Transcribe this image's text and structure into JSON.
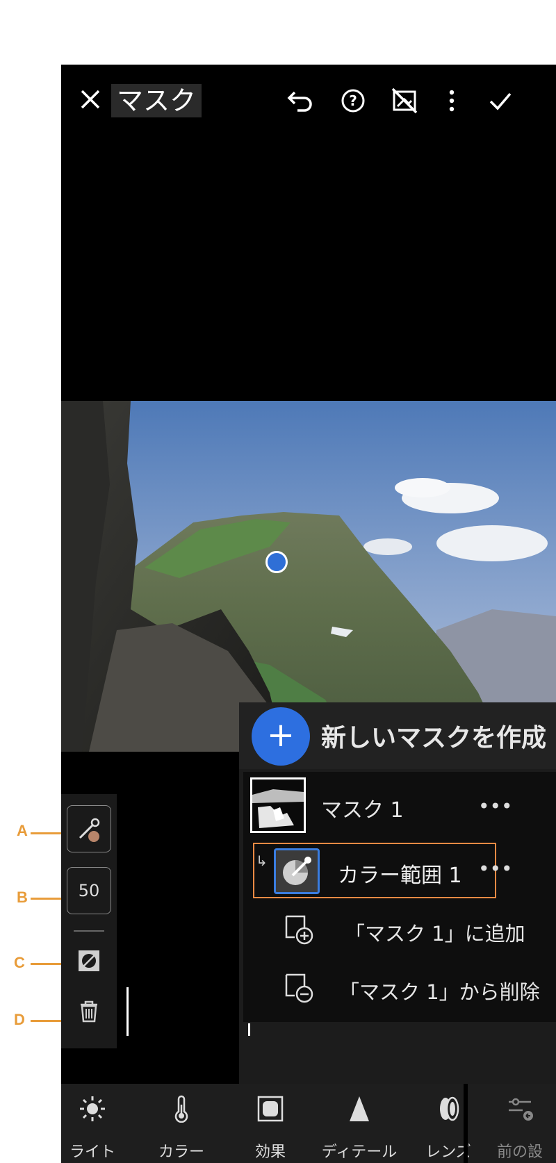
{
  "header": {
    "title": "マスク"
  },
  "photo": {
    "subject": "mountain-landscape"
  },
  "mask_panel": {
    "create_new_label": "新しいマスクを作成",
    "create_new_symbol": "+",
    "mask_name": "マスク 1",
    "color_range_name": "カラー範囲 1",
    "add_to_mask": "「マスク 1」に追加",
    "subtract_from_mask": "「マスク 1」から削除",
    "more_symbol": "•••"
  },
  "left_tools": {
    "amount_value": "50"
  },
  "callouts": [
    "A",
    "B",
    "C",
    "D"
  ],
  "bottom_bar": {
    "items": [
      {
        "label": "ライト",
        "icon": "sun-icon"
      },
      {
        "label": "カラー",
        "icon": "thermometer-icon"
      },
      {
        "label": "効果",
        "icon": "effects-icon"
      },
      {
        "label": "ディテール",
        "icon": "detail-triangle-icon"
      },
      {
        "label": "レンズ",
        "icon": "lens-icon"
      },
      {
        "label": "前の設",
        "icon": "previous-settings-icon"
      }
    ]
  },
  "colors": {
    "accent_blue": "#2d6fe0",
    "highlight_orange": "#f08a44",
    "callout_orange": "#e89c3a"
  }
}
